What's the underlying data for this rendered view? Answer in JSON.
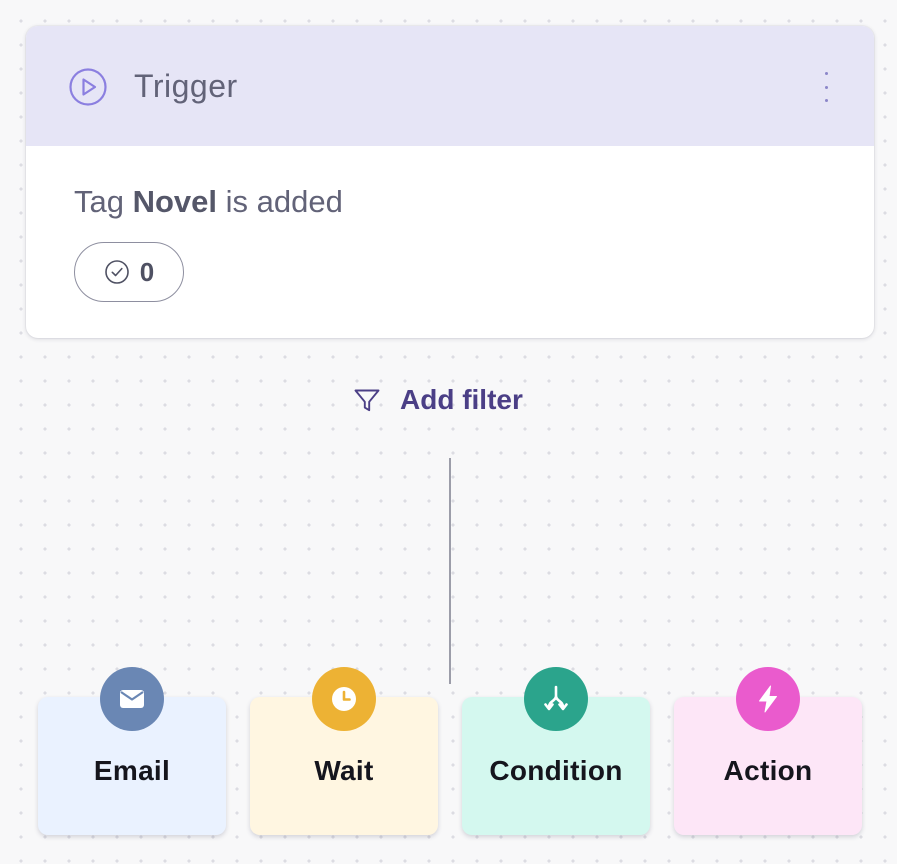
{
  "trigger": {
    "title": "Trigger",
    "description_prefix": "Tag",
    "tag_name": "Novel",
    "description_suffix": "is added",
    "completed_count": "0",
    "icons": {
      "header": "play-circle-icon",
      "menu": "more-vertical-icon",
      "count": "check-circle-icon"
    }
  },
  "filter": {
    "label": "Add filter",
    "icon": "funnel-icon"
  },
  "nodes": [
    {
      "label": "Email",
      "icon": "envelope-icon",
      "color": "#6a87b4",
      "background": "#eaf2ff"
    },
    {
      "label": "Wait",
      "icon": "clock-icon",
      "color": "#edb234",
      "background": "#fff6e1"
    },
    {
      "label": "Condition",
      "icon": "split-arrows-icon",
      "color": "#2ba48c",
      "background": "#d4f8ef"
    },
    {
      "label": "Action",
      "icon": "lightning-icon",
      "color": "#ea5bcd",
      "background": "#fde6f7"
    }
  ],
  "colors": {
    "accent": "#8b86c9",
    "filter_text": "#4b3f86",
    "header_bg": "#e6e5f6"
  }
}
